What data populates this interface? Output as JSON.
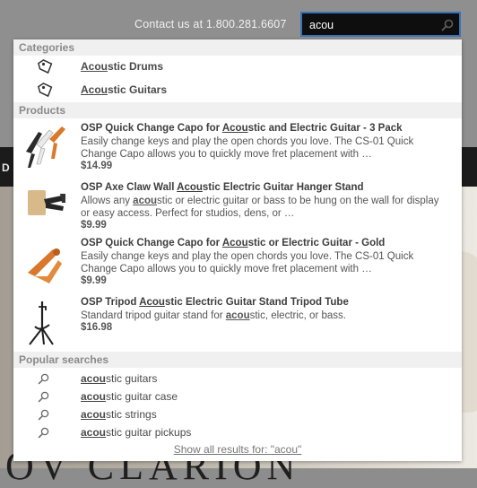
{
  "header": {
    "contact_text": "Contact us at 1.800.281.6607"
  },
  "background": {
    "nav_fragment": "D",
    "hero_text": "OV  CLARION"
  },
  "search": {
    "value": "acou",
    "icon": "search-icon"
  },
  "sections": {
    "categories": "Categories",
    "products": "Products",
    "popular": "Popular searches"
  },
  "categories": [
    {
      "match": "Acou",
      "rest": "stic Drums",
      "icon": "tag-icon"
    },
    {
      "match": "Acou",
      "rest": "stic Guitars",
      "icon": "tag-icon"
    }
  ],
  "products": [
    {
      "title_pre": "OSP Quick Change Capo for ",
      "title_match": "Acou",
      "title_post": "stic and Electric Guitar - 3 Pack",
      "desc_pre": "Easily change keys and play the open chords you love. The CS-01 Quick Change Capo allows you to quickly move fret placement with …",
      "desc_match": "",
      "desc_post": "",
      "price": "$14.99",
      "thumb": "capo-3-pack-image"
    },
    {
      "title_pre": "OSP Axe Claw Wall ",
      "title_match": "Acou",
      "title_post": "stic Electric Guitar Hanger Stand",
      "desc_pre": "Allows any ",
      "desc_match": "acou",
      "desc_post": "stic or electric guitar or bass to be hung on the wall for display or easy access. Perfect for studios, dens, or …",
      "price": "$9.99",
      "thumb": "wall-hanger-image"
    },
    {
      "title_pre": "OSP Quick Change Capo for ",
      "title_match": "Acou",
      "title_post": "stic or Electric Guitar - Gold",
      "desc_pre": "Easily change keys and play the open chords you love. The CS-01 Quick Change Capo allows you to quickly move fret placement with …",
      "desc_match": "",
      "desc_post": "",
      "price": "$9.99",
      "thumb": "gold-capo-image"
    },
    {
      "title_pre": "OSP Tripod ",
      "title_match": "Acou",
      "title_post": "stic Electric Guitar Stand Tripod Tube",
      "desc_pre": "Standard tripod guitar stand for ",
      "desc_match": "acou",
      "desc_post": "stic, electric, or bass.",
      "price": "$16.98",
      "thumb": "tripod-stand-image"
    }
  ],
  "popular": [
    {
      "match": "acou",
      "rest": "stic guitars"
    },
    {
      "match": "acou",
      "rest": "stic guitar case"
    },
    {
      "match": "acou",
      "rest": "stic strings"
    },
    {
      "match": "acou",
      "rest": "stic guitar pickups"
    }
  ],
  "show_all": "Show all results for: \"acou\""
}
